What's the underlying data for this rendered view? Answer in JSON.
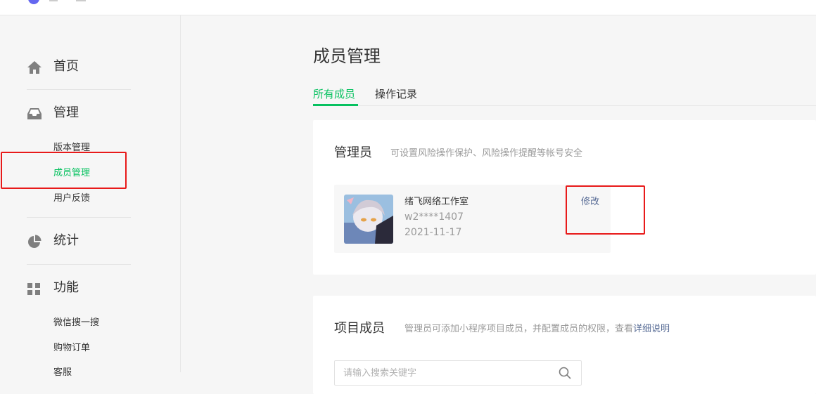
{
  "sidebar": {
    "home": {
      "label": "首页",
      "icon": "home-icon"
    },
    "manage": {
      "label": "管理",
      "icon": "inbox-icon",
      "items": [
        {
          "label": "版本管理",
          "active": false
        },
        {
          "label": "成员管理",
          "active": true
        },
        {
          "label": "用户反馈",
          "active": false
        }
      ]
    },
    "stats": {
      "label": "统计",
      "icon": "pie-chart-icon"
    },
    "features": {
      "label": "功能",
      "icon": "grid-icon",
      "items": [
        {
          "label": "微信搜一搜"
        },
        {
          "label": "购物订单"
        },
        {
          "label": "客服"
        }
      ]
    }
  },
  "main": {
    "title": "成员管理",
    "tabs": [
      {
        "label": "所有成员",
        "active": true
      },
      {
        "label": "操作记录",
        "active": false
      }
    ],
    "admin_section": {
      "title": "管理员",
      "desc": "可设置风险操作保护、风险操作提醒等帐号安全",
      "admin": {
        "name": "绪飞网络工作室",
        "id": "w2****1407",
        "date": "2021-11-17"
      },
      "edit_label": "修改"
    },
    "members_section": {
      "title": "项目成员",
      "desc": "管理员可添加小程序项目成员，并配置成员的权限，查看",
      "desc_link": "详细说明",
      "search_placeholder": "请输入搜索关键字"
    }
  },
  "colors": {
    "accent": "#07c160",
    "link": "#576b95",
    "highlight_box": "#e81a1a"
  }
}
